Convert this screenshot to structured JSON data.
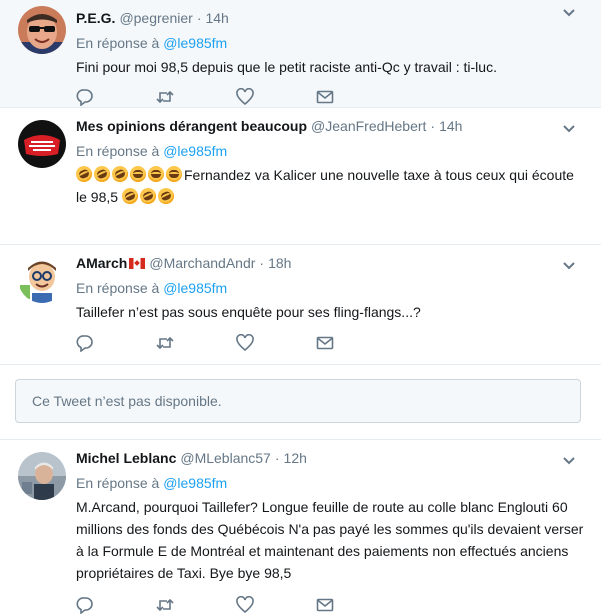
{
  "colors": {
    "link": "#1da1f2",
    "muted": "#657786",
    "text": "#14171a"
  },
  "tweets": [
    {
      "name": "P.E.G.",
      "handle": "@pegrenier",
      "dot": "·",
      "time": "14h",
      "reply_prefix": "En réponse à",
      "reply_to": "@le985fm",
      "text": "Fini pour moi 98,5 depuis que le petit raciste anti-Qc y travail : ti-luc."
    },
    {
      "name": "Mes opinions dérangent beaucoup",
      "handle": "@JeanFredHebert",
      "dot": "·",
      "time": "14h",
      "reply_prefix": "En réponse à",
      "reply_to": "@le985fm",
      "text_part1": "Fernandez va Kalicer une nouvelle taxe à tous ceux qui écoute",
      "text_part2": "le 98,5"
    },
    {
      "name": "AMarch",
      "handle": "@MarchandAndr",
      "dot": "·",
      "time": "18h",
      "reply_prefix": "En réponse à",
      "reply_to": "@le985fm",
      "text": "Taillefer n’est pas sous enquête pour ses fling-flangs...?"
    },
    {
      "name": "Michel Leblanc",
      "handle": "@MLeblanc57",
      "dot": "·",
      "time": "12h",
      "reply_prefix": "En réponse à",
      "reply_to": "@le985fm",
      "text": "M.Arcand, pourquoi Taillefer? Longue feuille de route au colle blanc Englouti 60 millions des fonds des Québécois N'a pas payé les sommes qu'ils devaient verser à la Formule E de Montréal et maintenant des paiements non effectués anciens propriétaires de Taxi. Bye bye 98,5"
    }
  ],
  "unavailable": {
    "text": "Ce Tweet n’est pas disponible."
  },
  "icons": [
    "reply-icon",
    "retweet-icon",
    "like-icon",
    "direct-message-icon",
    "chevron-down-icon"
  ]
}
